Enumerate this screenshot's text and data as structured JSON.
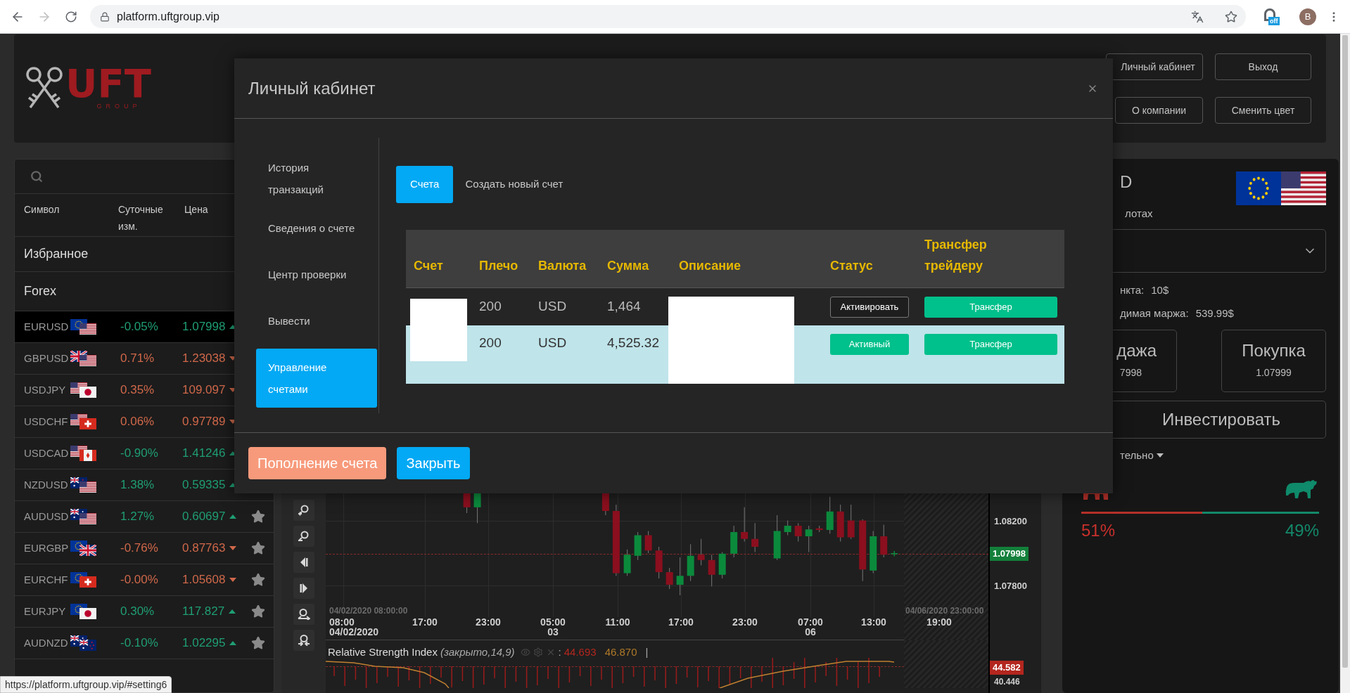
{
  "browser": {
    "url": "platform.uftgroup.vip",
    "extension_badge": "off",
    "avatar_letter": "B",
    "status_url": "https://platform.uftgroup.vip/#setting6"
  },
  "header": {
    "logo": {
      "wordmark": "UFT",
      "tagline": "GROUP"
    },
    "buttons": [
      "Личный кабинет",
      "Выход",
      "О компании",
      "Сменить цвет"
    ]
  },
  "watchlist": {
    "columns": [
      "Символ",
      "Суточные изм.",
      "Цена"
    ],
    "groups": [
      "Избранное",
      "Forex"
    ],
    "rows": [
      {
        "symbol": "EURUSD",
        "flags": [
          {
            "kind": "eu"
          },
          {
            "kind": "us"
          }
        ],
        "change": "-0.05%",
        "price": "1.07998",
        "kind": "up",
        "selected": true
      },
      {
        "symbol": "GBPUSD",
        "flags": [
          {
            "kind": "gb"
          },
          {
            "kind": "us"
          }
        ],
        "change": "0.71%",
        "price": "1.23038",
        "kind": "down",
        "selected": false
      },
      {
        "symbol": "USDJPY",
        "flags": [
          {
            "kind": "us"
          },
          {
            "kind": "jp"
          }
        ],
        "change": "0.35%",
        "price": "109.097",
        "kind": "down",
        "selected": false
      },
      {
        "symbol": "USDCHF",
        "flags": [
          {
            "kind": "us"
          },
          {
            "kind": "ch"
          }
        ],
        "change": "0.06%",
        "price": "0.97789",
        "kind": "down",
        "selected": false
      },
      {
        "symbol": "USDCAD",
        "flags": [
          {
            "kind": "us"
          },
          {
            "kind": "ca"
          }
        ],
        "change": "-0.90%",
        "price": "1.41246",
        "kind": "up",
        "selected": false
      },
      {
        "symbol": "NZDUSD",
        "flags": [
          {
            "kind": "nz"
          },
          {
            "kind": "us"
          }
        ],
        "change": "1.38%",
        "price": "0.59335",
        "kind": "up",
        "selected": false
      },
      {
        "symbol": "AUDUSD",
        "flags": [
          {
            "kind": "au"
          },
          {
            "kind": "us"
          }
        ],
        "change": "1.27%",
        "price": "0.60697",
        "kind": "up",
        "selected": false
      },
      {
        "symbol": "EURGBP",
        "flags": [
          {
            "kind": "eu"
          },
          {
            "kind": "gb"
          }
        ],
        "change": "-0.76%",
        "price": "0.87763",
        "kind": "down",
        "selected": false
      },
      {
        "symbol": "EURCHF",
        "flags": [
          {
            "kind": "eu"
          },
          {
            "kind": "ch"
          }
        ],
        "change": "-0.00%",
        "price": "1.05608",
        "kind": "down",
        "selected": false
      },
      {
        "symbol": "EURJPY",
        "flags": [
          {
            "kind": "eu"
          },
          {
            "kind": "jp"
          }
        ],
        "change": "0.30%",
        "price": "117.827",
        "kind": "up",
        "selected": false
      },
      {
        "symbol": "AUDNZD",
        "flags": [
          {
            "kind": "au"
          },
          {
            "kind": "nz"
          }
        ],
        "change": "-0.10%",
        "price": "1.02295",
        "kind": "up",
        "selected": false
      }
    ]
  },
  "chart": {
    "price_ticks": [
      "1.08200",
      "1.07800"
    ],
    "last_price": "1.07998",
    "range_start": "04/02/2020 08:00:00",
    "range_end": "04/06/2020 23:00:00",
    "time_labels": [
      {
        "time": "08:00",
        "date": "04/02/2020"
      },
      {
        "time": "17:00"
      },
      {
        "time": "23:00"
      },
      {
        "time": "05:00",
        "date": "03"
      },
      {
        "time": "11:00"
      },
      {
        "time": "17:00"
      },
      {
        "time": "23:00"
      },
      {
        "time": "07:00",
        "date": "06"
      },
      {
        "time": "13:00"
      },
      {
        "time": "19:00"
      }
    ],
    "indicator": {
      "name": "Relative Strength Index",
      "params": "(закрыто,14,9)",
      "separator": ":",
      "value_1": "44.693",
      "value_2": "46.870",
      "cursor": "|",
      "last_value": "44.582",
      "tick": "40.446"
    }
  },
  "trade_panel": {
    "title": "D",
    "flags": [
      {
        "kind": "eu"
      },
      {
        "kind": "us"
      }
    ],
    "lots_label": "лотах",
    "pip_label": "нкта:",
    "pip_value": "10$",
    "margin_label": "димая маржа:",
    "margin_value": "539.99$",
    "sell": {
      "label": "дажа",
      "price": "7998"
    },
    "buy": {
      "label": "Покупка",
      "price": "1.07999"
    },
    "invest": "Инвестировать",
    "more": "тельно",
    "sentiment": {
      "level": 0.51,
      "bear": "51%",
      "bull": "49%"
    }
  },
  "modal": {
    "title": "Личный кабинет",
    "nav": [
      {
        "label": "История транзакций",
        "selected": false
      },
      {
        "label": "Сведения о счете",
        "selected": false
      },
      {
        "label": "Центр проверки",
        "selected": false
      },
      {
        "label": "Вывести",
        "selected": false
      },
      {
        "label": "Управление счетами",
        "selected": true
      }
    ],
    "tabs": [
      {
        "label": "Счета",
        "selected": true
      },
      {
        "label": "Создать новый счет",
        "selected": false
      }
    ],
    "table": {
      "columns": [
        "Счет",
        "Плечо",
        "Валюта",
        "Сумма",
        "Описание",
        "Статус",
        "Трансфер трейдеру"
      ],
      "rows": [
        {
          "leverage": "200",
          "currency": "USD",
          "amount": "1,464",
          "status": {
            "kind": "inactive",
            "label": "Активировать"
          },
          "transfer": "Трансфер",
          "selected": false
        },
        {
          "leverage": "200",
          "currency": "USD",
          "amount": "4,525.32",
          "status": {
            "kind": "active",
            "label": "Активный"
          },
          "transfer": "Трансфер",
          "selected": true
        }
      ]
    },
    "footer": [
      {
        "label": "Пополнение счета",
        "kind": "deposit"
      },
      {
        "label": "Закрыть",
        "kind": "close"
      }
    ]
  }
}
